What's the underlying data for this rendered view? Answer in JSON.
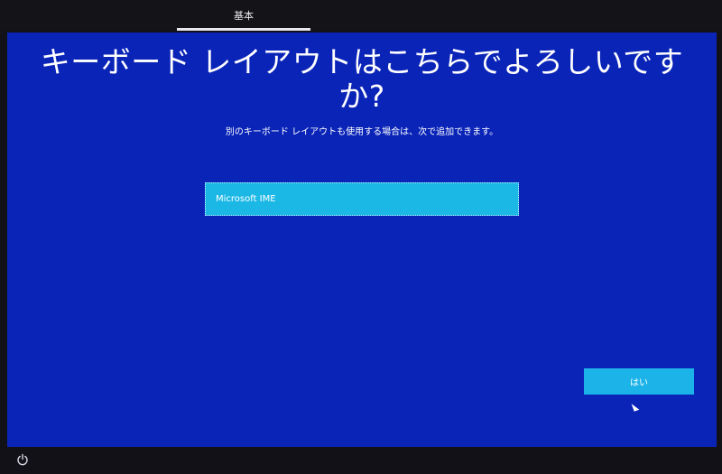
{
  "header": {
    "step_label": "基本"
  },
  "main": {
    "title": "キーボード レイアウトはこちらでよろしいですか?",
    "subtitle": "別のキーボード レイアウトも使用する場合は、次で追加できます。",
    "layouts": [
      {
        "label": "Microsoft IME",
        "selected": true
      }
    ]
  },
  "actions": {
    "yes_label": "はい"
  },
  "footer": {
    "power_icon": "power-icon"
  },
  "colors": {
    "background": "#0a24b8",
    "accent": "#1cb3e8",
    "text": "#ffffff"
  }
}
